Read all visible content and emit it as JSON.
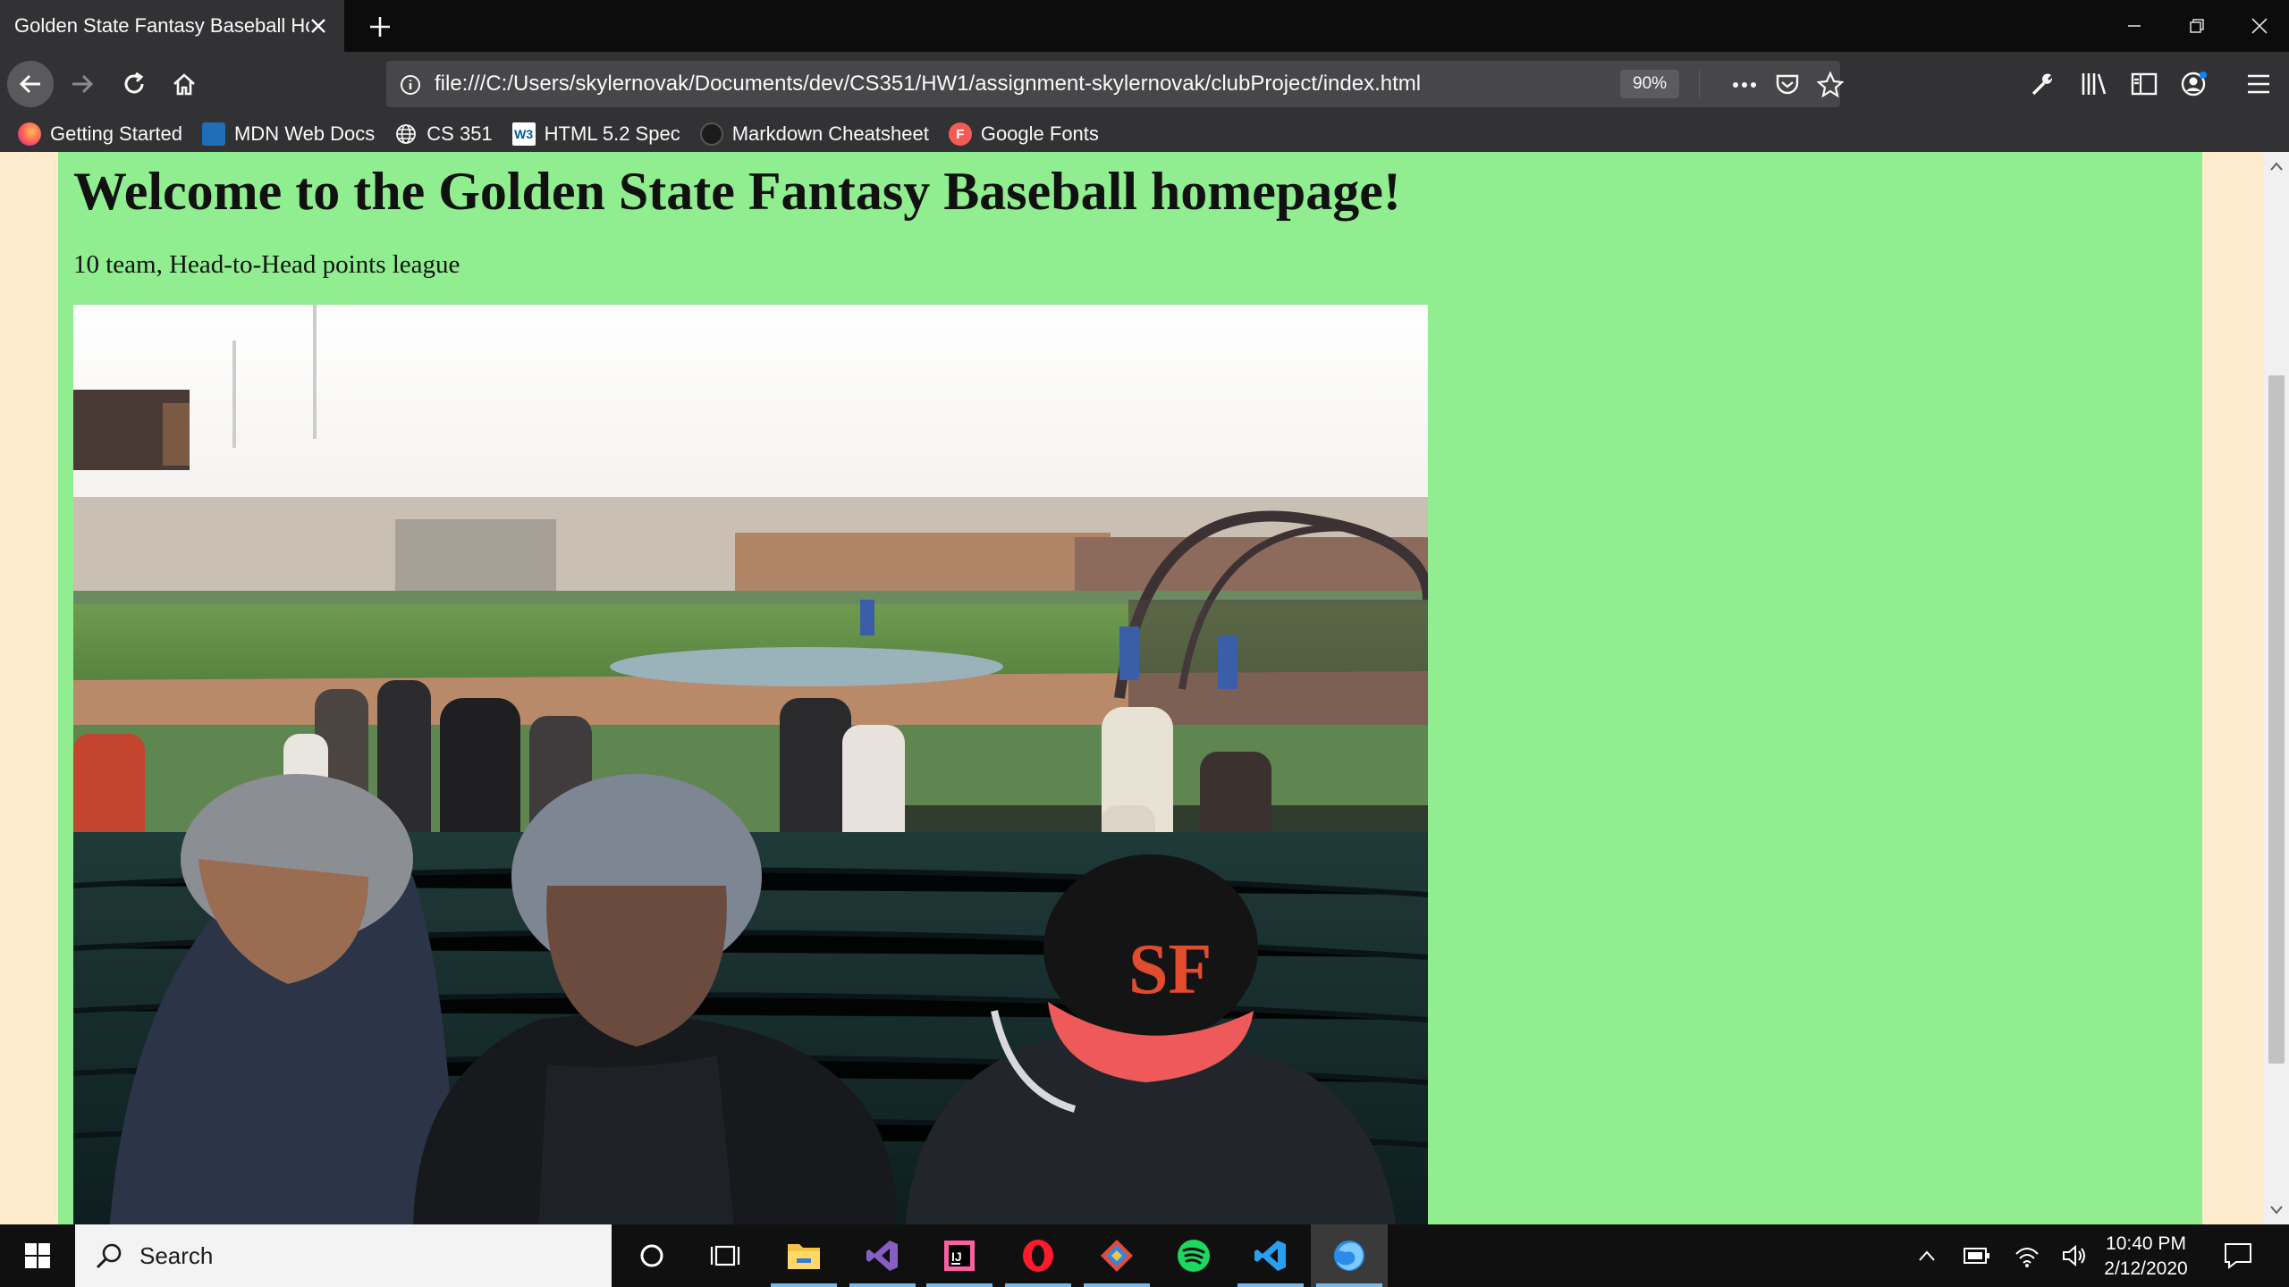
{
  "browser": {
    "tab_title": "Golden State Fantasy Baseball Hom",
    "url": "file:///C:/Users/skylernovak/Documents/dev/CS351/HW1/assignment-skylernovak/clubProject/index.html",
    "zoom": "90%",
    "bookmarks": [
      {
        "label": "Getting Started",
        "icon": "firefox-icon"
      },
      {
        "label": "MDN Web Docs",
        "icon": "mdn-icon"
      },
      {
        "label": "CS 351",
        "icon": "globe-icon"
      },
      {
        "label": "HTML 5.2 Spec",
        "icon": "w3c-icon"
      },
      {
        "label": "Markdown Cheatsheet",
        "icon": "github-icon"
      },
      {
        "label": "Google Fonts",
        "icon": "google-fonts-icon"
      }
    ]
  },
  "page": {
    "heading": "Welcome to the Golden State Fantasy Baseball homepage!",
    "subtitle": "10 team, Head-to-Head points league",
    "background": "#ffebcd",
    "content_background": "#90ee90",
    "image_icon": "ballpark-photo"
  },
  "taskbar": {
    "search_placeholder": "Search",
    "apps": [
      "cortana-icon",
      "task-view-icon",
      "file-explorer-icon",
      "visual-studio-icon",
      "intellij-icon",
      "opera-icon",
      "git-kraken-icon",
      "spotify-icon",
      "vscode-icon",
      "firefox-icon"
    ],
    "time": "10:40 PM",
    "date": "2/12/2020"
  }
}
